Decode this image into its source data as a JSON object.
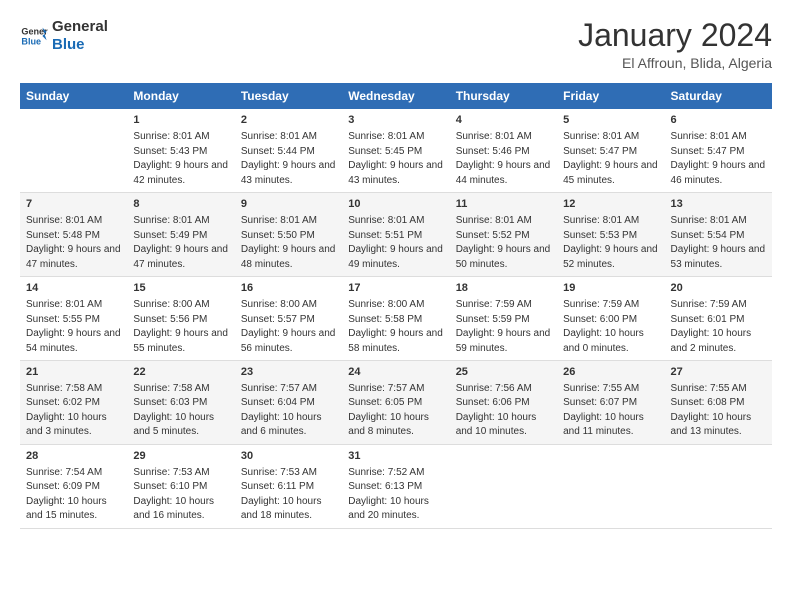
{
  "logo": {
    "text_general": "General",
    "text_blue": "Blue"
  },
  "title": "January 2024",
  "location": "El Affroun, Blida, Algeria",
  "headers": [
    "Sunday",
    "Monday",
    "Tuesday",
    "Wednesday",
    "Thursday",
    "Friday",
    "Saturday"
  ],
  "weeks": [
    [
      {
        "day": "",
        "sunrise": "",
        "sunset": "",
        "daylight": ""
      },
      {
        "day": "1",
        "sunrise": "Sunrise: 8:01 AM",
        "sunset": "Sunset: 5:43 PM",
        "daylight": "Daylight: 9 hours and 42 minutes."
      },
      {
        "day": "2",
        "sunrise": "Sunrise: 8:01 AM",
        "sunset": "Sunset: 5:44 PM",
        "daylight": "Daylight: 9 hours and 43 minutes."
      },
      {
        "day": "3",
        "sunrise": "Sunrise: 8:01 AM",
        "sunset": "Sunset: 5:45 PM",
        "daylight": "Daylight: 9 hours and 43 minutes."
      },
      {
        "day": "4",
        "sunrise": "Sunrise: 8:01 AM",
        "sunset": "Sunset: 5:46 PM",
        "daylight": "Daylight: 9 hours and 44 minutes."
      },
      {
        "day": "5",
        "sunrise": "Sunrise: 8:01 AM",
        "sunset": "Sunset: 5:47 PM",
        "daylight": "Daylight: 9 hours and 45 minutes."
      },
      {
        "day": "6",
        "sunrise": "Sunrise: 8:01 AM",
        "sunset": "Sunset: 5:47 PM",
        "daylight": "Daylight: 9 hours and 46 minutes."
      }
    ],
    [
      {
        "day": "7",
        "sunrise": "Sunrise: 8:01 AM",
        "sunset": "Sunset: 5:48 PM",
        "daylight": "Daylight: 9 hours and 47 minutes."
      },
      {
        "day": "8",
        "sunrise": "Sunrise: 8:01 AM",
        "sunset": "Sunset: 5:49 PM",
        "daylight": "Daylight: 9 hours and 47 minutes."
      },
      {
        "day": "9",
        "sunrise": "Sunrise: 8:01 AM",
        "sunset": "Sunset: 5:50 PM",
        "daylight": "Daylight: 9 hours and 48 minutes."
      },
      {
        "day": "10",
        "sunrise": "Sunrise: 8:01 AM",
        "sunset": "Sunset: 5:51 PM",
        "daylight": "Daylight: 9 hours and 49 minutes."
      },
      {
        "day": "11",
        "sunrise": "Sunrise: 8:01 AM",
        "sunset": "Sunset: 5:52 PM",
        "daylight": "Daylight: 9 hours and 50 minutes."
      },
      {
        "day": "12",
        "sunrise": "Sunrise: 8:01 AM",
        "sunset": "Sunset: 5:53 PM",
        "daylight": "Daylight: 9 hours and 52 minutes."
      },
      {
        "day": "13",
        "sunrise": "Sunrise: 8:01 AM",
        "sunset": "Sunset: 5:54 PM",
        "daylight": "Daylight: 9 hours and 53 minutes."
      }
    ],
    [
      {
        "day": "14",
        "sunrise": "Sunrise: 8:01 AM",
        "sunset": "Sunset: 5:55 PM",
        "daylight": "Daylight: 9 hours and 54 minutes."
      },
      {
        "day": "15",
        "sunrise": "Sunrise: 8:00 AM",
        "sunset": "Sunset: 5:56 PM",
        "daylight": "Daylight: 9 hours and 55 minutes."
      },
      {
        "day": "16",
        "sunrise": "Sunrise: 8:00 AM",
        "sunset": "Sunset: 5:57 PM",
        "daylight": "Daylight: 9 hours and 56 minutes."
      },
      {
        "day": "17",
        "sunrise": "Sunrise: 8:00 AM",
        "sunset": "Sunset: 5:58 PM",
        "daylight": "Daylight: 9 hours and 58 minutes."
      },
      {
        "day": "18",
        "sunrise": "Sunrise: 7:59 AM",
        "sunset": "Sunset: 5:59 PM",
        "daylight": "Daylight: 9 hours and 59 minutes."
      },
      {
        "day": "19",
        "sunrise": "Sunrise: 7:59 AM",
        "sunset": "Sunset: 6:00 PM",
        "daylight": "Daylight: 10 hours and 0 minutes."
      },
      {
        "day": "20",
        "sunrise": "Sunrise: 7:59 AM",
        "sunset": "Sunset: 6:01 PM",
        "daylight": "Daylight: 10 hours and 2 minutes."
      }
    ],
    [
      {
        "day": "21",
        "sunrise": "Sunrise: 7:58 AM",
        "sunset": "Sunset: 6:02 PM",
        "daylight": "Daylight: 10 hours and 3 minutes."
      },
      {
        "day": "22",
        "sunrise": "Sunrise: 7:58 AM",
        "sunset": "Sunset: 6:03 PM",
        "daylight": "Daylight: 10 hours and 5 minutes."
      },
      {
        "day": "23",
        "sunrise": "Sunrise: 7:57 AM",
        "sunset": "Sunset: 6:04 PM",
        "daylight": "Daylight: 10 hours and 6 minutes."
      },
      {
        "day": "24",
        "sunrise": "Sunrise: 7:57 AM",
        "sunset": "Sunset: 6:05 PM",
        "daylight": "Daylight: 10 hours and 8 minutes."
      },
      {
        "day": "25",
        "sunrise": "Sunrise: 7:56 AM",
        "sunset": "Sunset: 6:06 PM",
        "daylight": "Daylight: 10 hours and 10 minutes."
      },
      {
        "day": "26",
        "sunrise": "Sunrise: 7:55 AM",
        "sunset": "Sunset: 6:07 PM",
        "daylight": "Daylight: 10 hours and 11 minutes."
      },
      {
        "day": "27",
        "sunrise": "Sunrise: 7:55 AM",
        "sunset": "Sunset: 6:08 PM",
        "daylight": "Daylight: 10 hours and 13 minutes."
      }
    ],
    [
      {
        "day": "28",
        "sunrise": "Sunrise: 7:54 AM",
        "sunset": "Sunset: 6:09 PM",
        "daylight": "Daylight: 10 hours and 15 minutes."
      },
      {
        "day": "29",
        "sunrise": "Sunrise: 7:53 AM",
        "sunset": "Sunset: 6:10 PM",
        "daylight": "Daylight: 10 hours and 16 minutes."
      },
      {
        "day": "30",
        "sunrise": "Sunrise: 7:53 AM",
        "sunset": "Sunset: 6:11 PM",
        "daylight": "Daylight: 10 hours and 18 minutes."
      },
      {
        "day": "31",
        "sunrise": "Sunrise: 7:52 AM",
        "sunset": "Sunset: 6:13 PM",
        "daylight": "Daylight: 10 hours and 20 minutes."
      },
      {
        "day": "",
        "sunrise": "",
        "sunset": "",
        "daylight": ""
      },
      {
        "day": "",
        "sunrise": "",
        "sunset": "",
        "daylight": ""
      },
      {
        "day": "",
        "sunrise": "",
        "sunset": "",
        "daylight": ""
      }
    ]
  ]
}
